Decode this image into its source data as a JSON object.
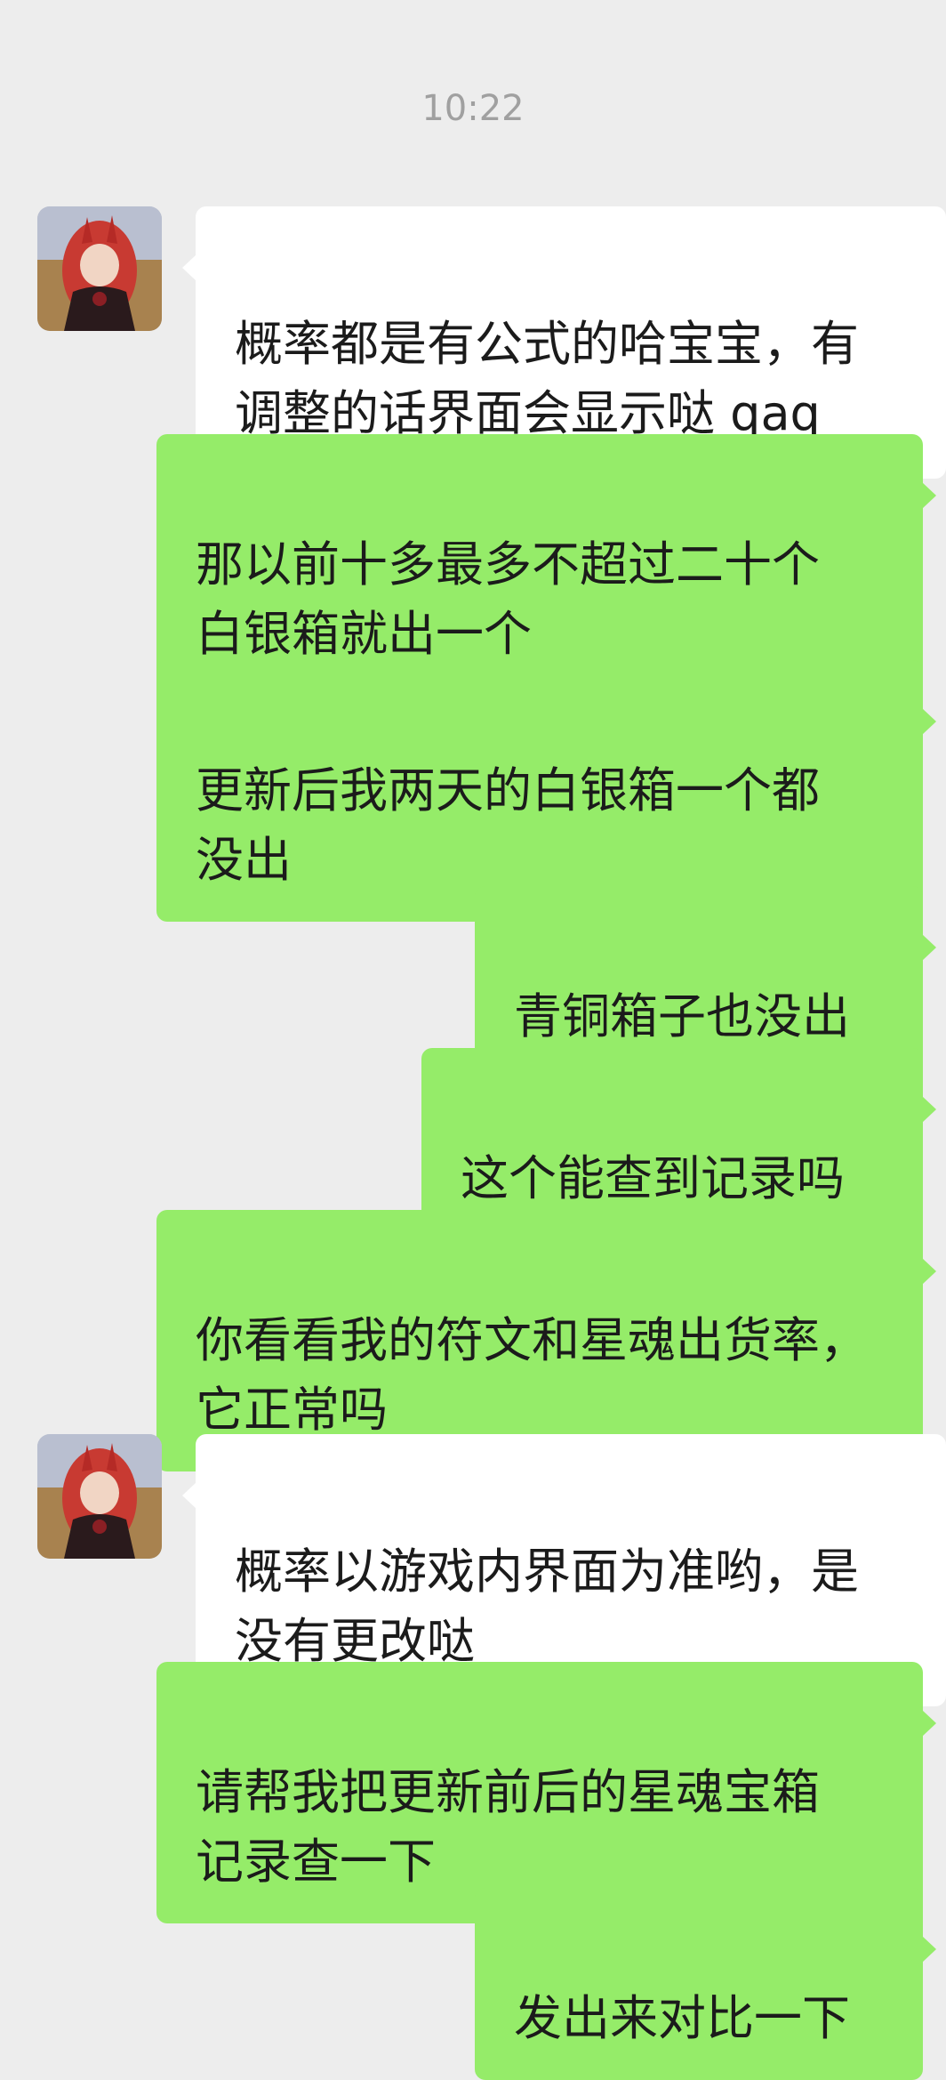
{
  "timestamp": "10:22",
  "messages": [
    {
      "sender": "other",
      "text": "概率都是有公式的哈宝宝，有\n调整的话界面会显示哒 qaq"
    },
    {
      "sender": "me",
      "text": "那以前十多最多不超过二十个\n白银箱就出一个"
    },
    {
      "sender": "me",
      "text": "更新后我两天的白银箱一个都\n没出"
    },
    {
      "sender": "me",
      "text": "青铜箱子也没出"
    },
    {
      "sender": "me",
      "text": "这个能查到记录吗"
    },
    {
      "sender": "me",
      "text": "你看看我的符文和星魂出货率，\n它正常吗"
    },
    {
      "sender": "other",
      "text": "概率以游戏内界面为准哟，是\n没有更改哒"
    },
    {
      "sender": "me",
      "text": "请帮我把更新前后的星魂宝箱\n记录查一下"
    },
    {
      "sender": "me",
      "text": "发出来对比一下"
    }
  ],
  "colors": {
    "background": "#ededed",
    "outgoing_bubble": "#95ec69",
    "incoming_bubble": "#ffffff",
    "timestamp_text": "#a0a0a0"
  },
  "icons": {
    "contact_avatar": "anime-character-avatar-icon"
  }
}
